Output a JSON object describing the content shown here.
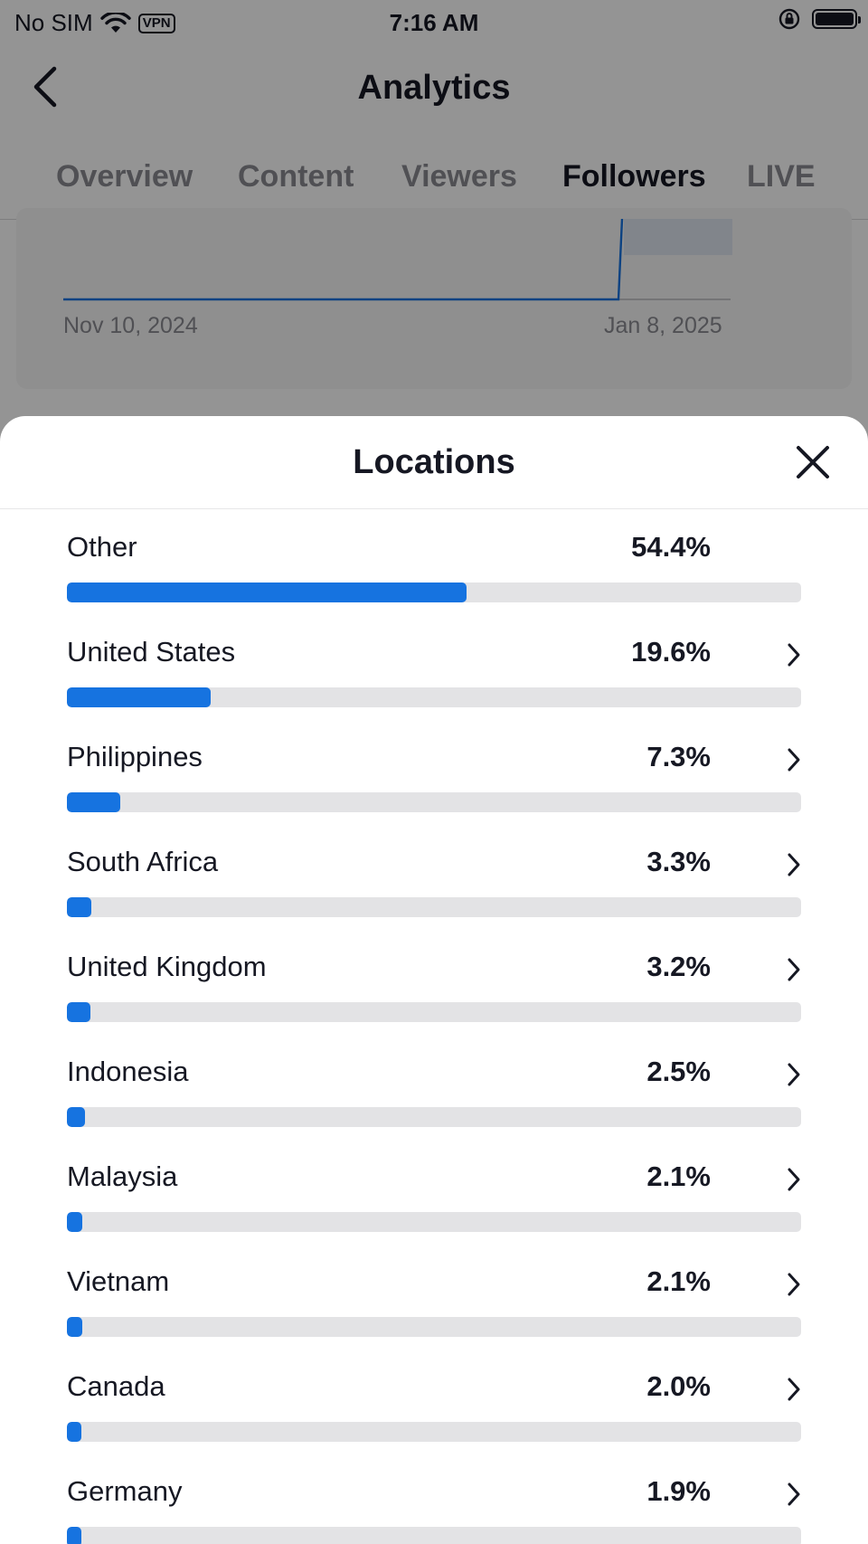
{
  "status_bar": {
    "carrier": "No SIM",
    "vpn": "VPN",
    "time": "7:16 AM"
  },
  "nav": {
    "title": "Analytics"
  },
  "tabs": [
    {
      "label": "Overview",
      "active": false
    },
    {
      "label": "Content",
      "active": false
    },
    {
      "label": "Viewers",
      "active": false
    },
    {
      "label": "Followers",
      "active": true
    },
    {
      "label": "LIVE",
      "active": false
    }
  ],
  "chart": {
    "start_date": "Nov 10, 2024",
    "end_date": "Jan 8, 2025"
  },
  "sheet": {
    "title": "Locations",
    "close_icon": "close-icon"
  },
  "colors": {
    "bar_fill": "#1673e0",
    "bar_track": "#e3e3e5",
    "text": "#161823"
  },
  "locations": [
    {
      "name": "Other",
      "percent_label": "54.4%",
      "percent": 54.4,
      "has_chevron": false
    },
    {
      "name": "United States",
      "percent_label": "19.6%",
      "percent": 19.6,
      "has_chevron": true
    },
    {
      "name": "Philippines",
      "percent_label": "7.3%",
      "percent": 7.3,
      "has_chevron": true
    },
    {
      "name": "South Africa",
      "percent_label": "3.3%",
      "percent": 3.3,
      "has_chevron": true
    },
    {
      "name": "United Kingdom",
      "percent_label": "3.2%",
      "percent": 3.2,
      "has_chevron": true
    },
    {
      "name": "Indonesia",
      "percent_label": "2.5%",
      "percent": 2.5,
      "has_chevron": true
    },
    {
      "name": "Malaysia",
      "percent_label": "2.1%",
      "percent": 2.1,
      "has_chevron": true
    },
    {
      "name": "Vietnam",
      "percent_label": "2.1%",
      "percent": 2.1,
      "has_chevron": true
    },
    {
      "name": "Canada",
      "percent_label": "2.0%",
      "percent": 2.0,
      "has_chevron": true
    },
    {
      "name": "Germany",
      "percent_label": "1.9%",
      "percent": 1.9,
      "has_chevron": true
    }
  ]
}
